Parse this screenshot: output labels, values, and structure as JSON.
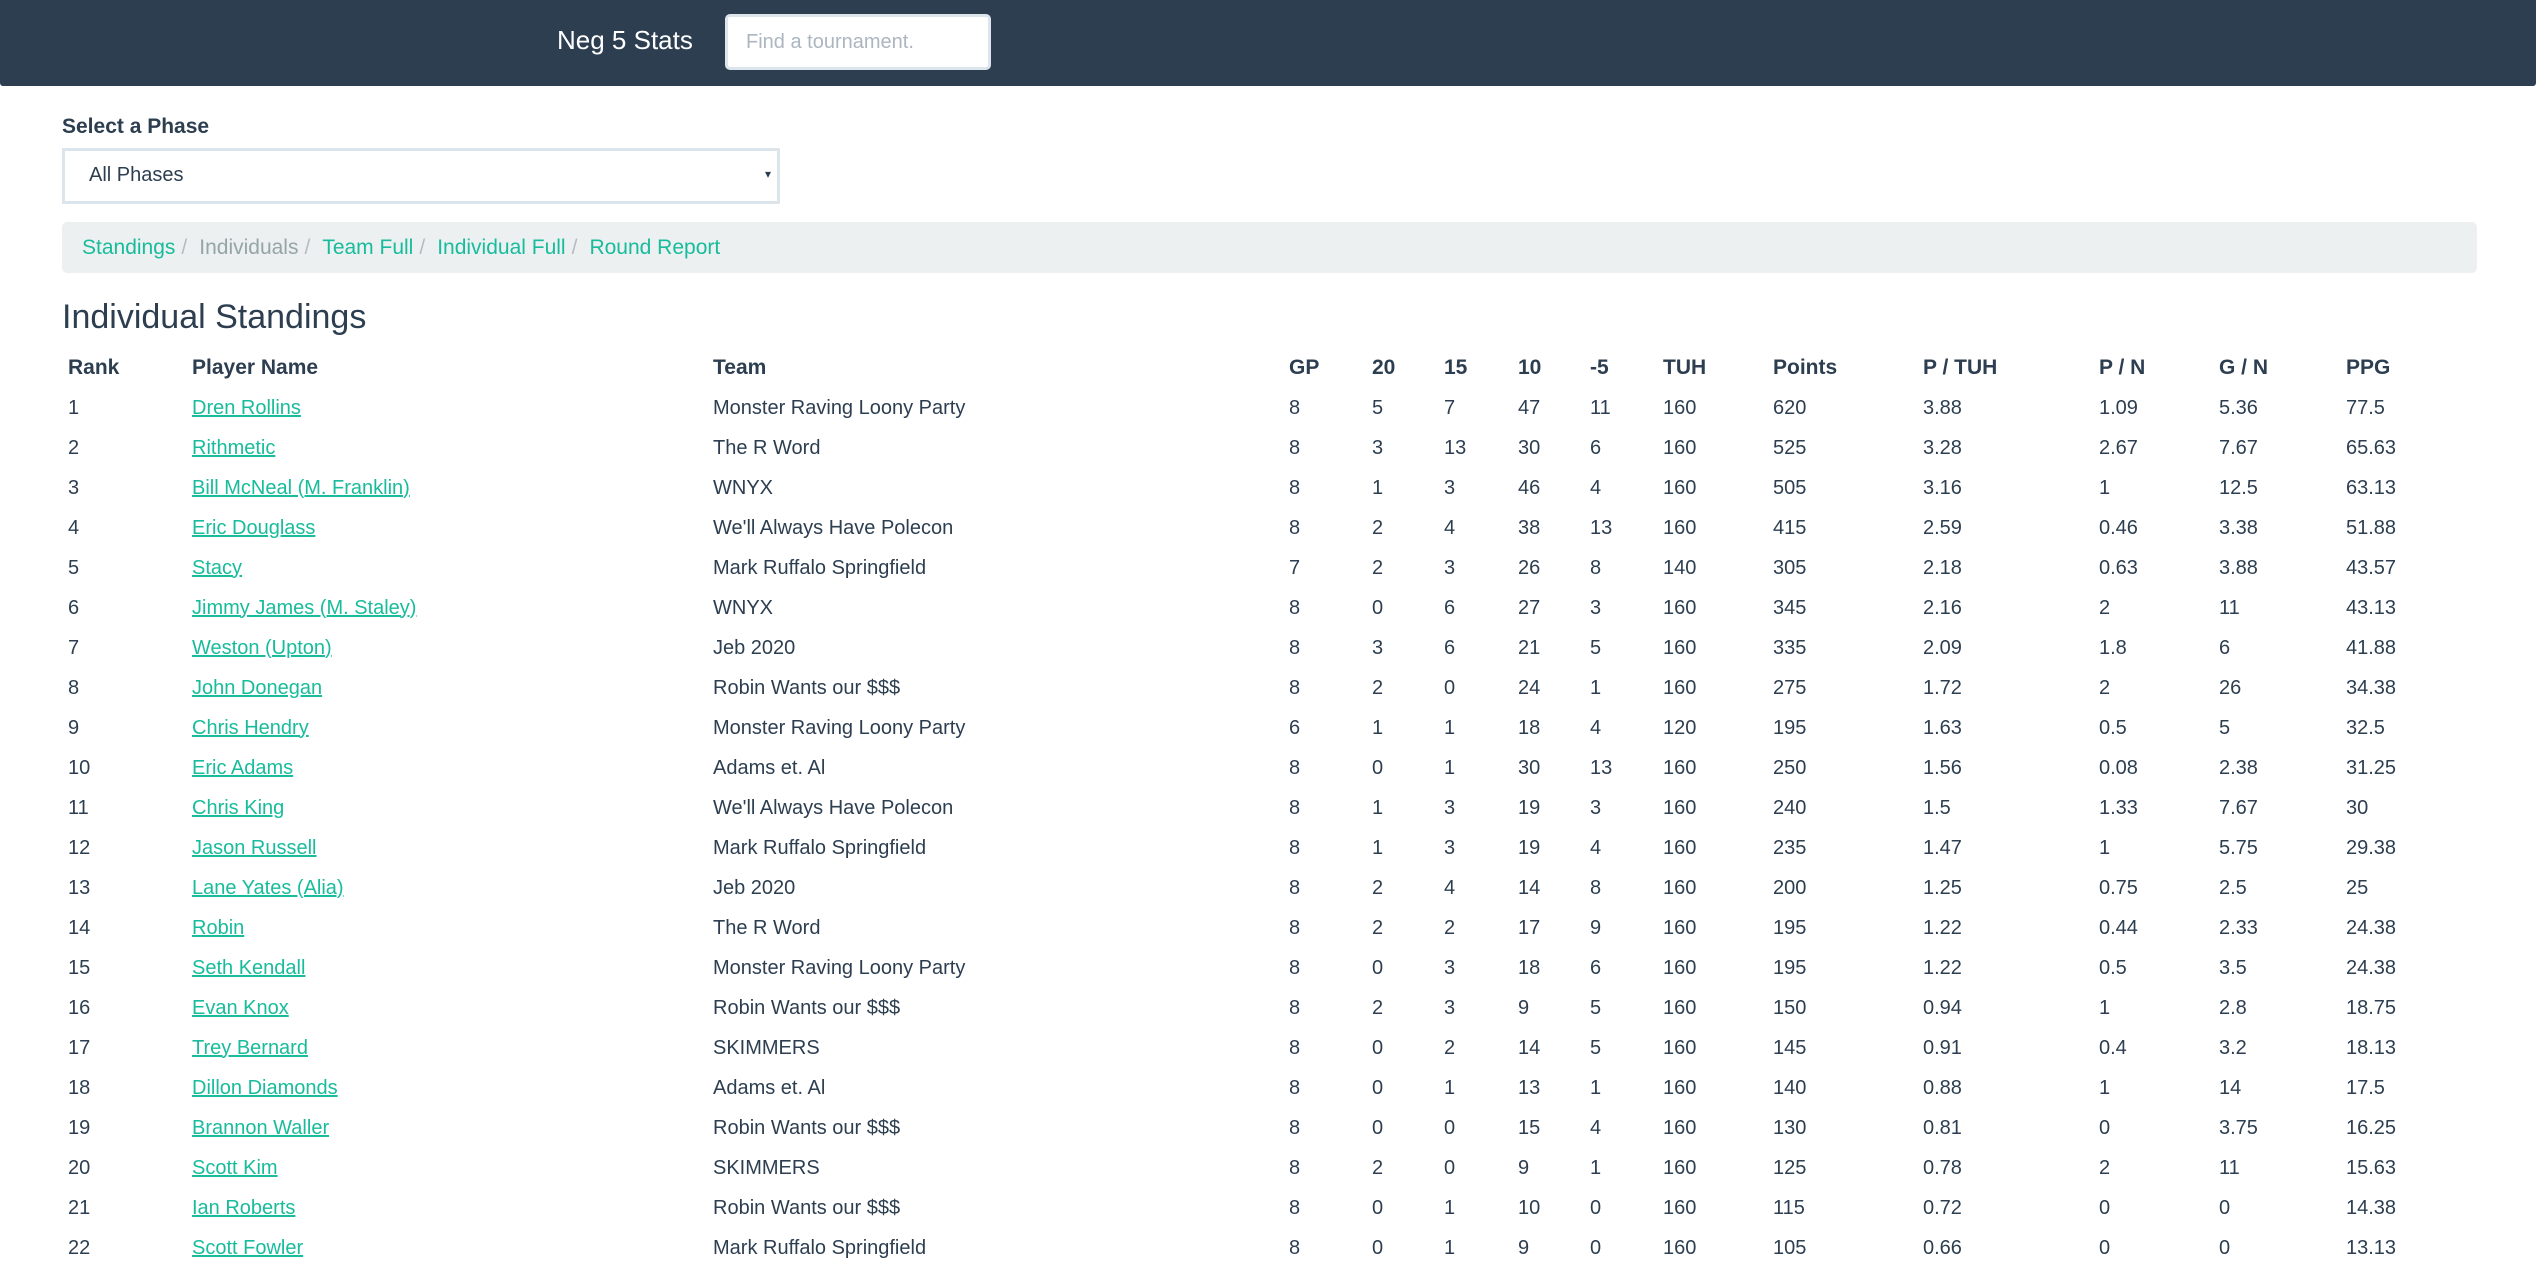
{
  "navbar": {
    "brand": "Neg 5 Stats",
    "search_placeholder": "Find a tournament.",
    "search_value": ""
  },
  "phase": {
    "label": "Select a Phase",
    "selected": "All Phases",
    "caret_icon": "▾"
  },
  "breadcrumb": [
    {
      "label": "Standings",
      "active": false
    },
    {
      "label": "Individuals",
      "active": true
    },
    {
      "label": "Team Full",
      "active": false
    },
    {
      "label": "Individual Full",
      "active": false
    },
    {
      "label": "Round Report",
      "active": false
    }
  ],
  "breadcrumb_separator": "/",
  "page_title": "Individual Standings",
  "colors": {
    "navbar": "#2c3e50",
    "link": "#18bc9c",
    "text": "#2c3e50",
    "breadcrumb_bg": "#ecf0f1"
  },
  "table": {
    "headers": [
      "Rank",
      "Player Name",
      "Team",
      "GP",
      "20",
      "15",
      "10",
      "-5",
      "TUH",
      "Points",
      "P / TUH",
      "P / N",
      "G / N",
      "PPG"
    ],
    "rows": [
      [
        "1",
        "Dren Rollins",
        "Monster Raving Loony Party",
        "8",
        "5",
        "7",
        "47",
        "11",
        "160",
        "620",
        "3.88",
        "1.09",
        "5.36",
        "77.5"
      ],
      [
        "2",
        "Rithmetic",
        "The R Word",
        "8",
        "3",
        "13",
        "30",
        "6",
        "160",
        "525",
        "3.28",
        "2.67",
        "7.67",
        "65.63"
      ],
      [
        "3",
        "Bill McNeal (M. Franklin)",
        "WNYX",
        "8",
        "1",
        "3",
        "46",
        "4",
        "160",
        "505",
        "3.16",
        "1",
        "12.5",
        "63.13"
      ],
      [
        "4",
        "Eric Douglass",
        "We'll Always Have Polecon",
        "8",
        "2",
        "4",
        "38",
        "13",
        "160",
        "415",
        "2.59",
        "0.46",
        "3.38",
        "51.88"
      ],
      [
        "5",
        "Stacy",
        "Mark Ruffalo Springfield",
        "7",
        "2",
        "3",
        "26",
        "8",
        "140",
        "305",
        "2.18",
        "0.63",
        "3.88",
        "43.57"
      ],
      [
        "6",
        "Jimmy James (M. Staley)",
        "WNYX",
        "8",
        "0",
        "6",
        "27",
        "3",
        "160",
        "345",
        "2.16",
        "2",
        "11",
        "43.13"
      ],
      [
        "7",
        "Weston (Upton)",
        "Jeb 2020",
        "8",
        "3",
        "6",
        "21",
        "5",
        "160",
        "335",
        "2.09",
        "1.8",
        "6",
        "41.88"
      ],
      [
        "8",
        "John Donegan",
        "Robin Wants our $$$",
        "8",
        "2",
        "0",
        "24",
        "1",
        "160",
        "275",
        "1.72",
        "2",
        "26",
        "34.38"
      ],
      [
        "9",
        "Chris Hendry",
        "Monster Raving Loony Party",
        "6",
        "1",
        "1",
        "18",
        "4",
        "120",
        "195",
        "1.63",
        "0.5",
        "5",
        "32.5"
      ],
      [
        "10",
        "Eric Adams",
        "Adams et. Al",
        "8",
        "0",
        "1",
        "30",
        "13",
        "160",
        "250",
        "1.56",
        "0.08",
        "2.38",
        "31.25"
      ],
      [
        "11",
        "Chris King",
        "We'll Always Have Polecon",
        "8",
        "1",
        "3",
        "19",
        "3",
        "160",
        "240",
        "1.5",
        "1.33",
        "7.67",
        "30"
      ],
      [
        "12",
        "Jason Russell",
        "Mark Ruffalo Springfield",
        "8",
        "1",
        "3",
        "19",
        "4",
        "160",
        "235",
        "1.47",
        "1",
        "5.75",
        "29.38"
      ],
      [
        "13",
        "Lane Yates (Alia)",
        "Jeb 2020",
        "8",
        "2",
        "4",
        "14",
        "8",
        "160",
        "200",
        "1.25",
        "0.75",
        "2.5",
        "25"
      ],
      [
        "14",
        "Robin",
        "The R Word",
        "8",
        "2",
        "2",
        "17",
        "9",
        "160",
        "195",
        "1.22",
        "0.44",
        "2.33",
        "24.38"
      ],
      [
        "15",
        "Seth Kendall",
        "Monster Raving Loony Party",
        "8",
        "0",
        "3",
        "18",
        "6",
        "160",
        "195",
        "1.22",
        "0.5",
        "3.5",
        "24.38"
      ],
      [
        "16",
        "Evan Knox",
        "Robin Wants our $$$",
        "8",
        "2",
        "3",
        "9",
        "5",
        "160",
        "150",
        "0.94",
        "1",
        "2.8",
        "18.75"
      ],
      [
        "17",
        "Trey Bernard",
        "SKIMMERS",
        "8",
        "0",
        "2",
        "14",
        "5",
        "160",
        "145",
        "0.91",
        "0.4",
        "3.2",
        "18.13"
      ],
      [
        "18",
        "Dillon Diamonds",
        "Adams et. Al",
        "8",
        "0",
        "1",
        "13",
        "1",
        "160",
        "140",
        "0.88",
        "1",
        "14",
        "17.5"
      ],
      [
        "19",
        "Brannon Waller",
        "Robin Wants our $$$",
        "8",
        "0",
        "0",
        "15",
        "4",
        "160",
        "130",
        "0.81",
        "0",
        "3.75",
        "16.25"
      ],
      [
        "20",
        "Scott Kim",
        "SKIMMERS",
        "8",
        "2",
        "0",
        "9",
        "1",
        "160",
        "125",
        "0.78",
        "2",
        "11",
        "15.63"
      ],
      [
        "21",
        "Ian Roberts",
        "Robin Wants our $$$",
        "8",
        "0",
        "1",
        "10",
        "0",
        "160",
        "115",
        "0.72",
        "0",
        "0",
        "14.38"
      ],
      [
        "22",
        "Scott Fowler",
        "Mark Ruffalo Springfield",
        "8",
        "0",
        "1",
        "9",
        "0",
        "160",
        "105",
        "0.66",
        "0",
        "0",
        "13.13"
      ]
    ]
  }
}
